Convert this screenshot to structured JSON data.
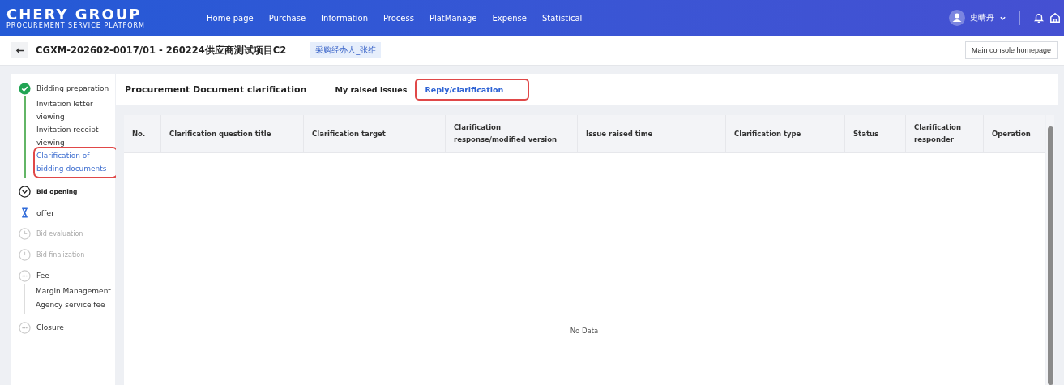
{
  "header": {
    "logo_title": "CHERY GROUP",
    "logo_subtitle": "PROCUREMENT SERVICE PLATFORM",
    "nav": [
      {
        "label": "Home page",
        "selected": false
      },
      {
        "label": "Purchase",
        "selected": false
      },
      {
        "label": "Information",
        "selected": false
      },
      {
        "label": "Process",
        "selected": false
      },
      {
        "label": "PlatManage",
        "selected": false
      },
      {
        "label": "Expense",
        "selected": false
      },
      {
        "label": "Statistical",
        "selected": false
      }
    ],
    "user": "史晴丹"
  },
  "project": {
    "title": "CGXM-202602-0017/01 - 260224供应商测试项目C2",
    "tag": "采购经办人_张维",
    "console_button": "Main console homepage"
  },
  "steps": [
    {
      "label": "Bidding preparation",
      "kind": "done",
      "children": [
        {
          "label": "Invitation letter viewing",
          "selected": false,
          "highlighted": false
        },
        {
          "label": "Invitation receipt viewing",
          "selected": false,
          "highlighted": false
        },
        {
          "label": "Clarification of bidding documents",
          "selected": true,
          "highlighted": true
        }
      ]
    },
    {
      "label": "Bid opening",
      "kind": "current"
    },
    {
      "label": "offer",
      "kind": "waiting"
    },
    {
      "label": "Bid evaluation",
      "kind": "pending"
    },
    {
      "label": "Bid finalization",
      "kind": "pending"
    },
    {
      "label": "Fee",
      "kind": "more",
      "children": [
        {
          "label": "Margin Management",
          "selected": false,
          "highlighted": false
        },
        {
          "label": "Agency service fee",
          "selected": false,
          "highlighted": false
        }
      ]
    },
    {
      "label": "Closure",
      "kind": "more"
    }
  ],
  "panel": {
    "title": "Procurement Document clarification",
    "tabs": [
      {
        "label": "My raised issues",
        "selected": false,
        "highlighted": false
      },
      {
        "label": "Reply/clarification",
        "selected": true,
        "highlighted": true
      }
    ]
  },
  "table": {
    "columns": [
      "No.",
      "Clarification question title",
      "Clarification target",
      "Clarification response/modified version",
      "Issue raised time",
      "Clarification type",
      "Status",
      "Clarification responder",
      "Operation"
    ],
    "empty_text": "No Data"
  }
}
